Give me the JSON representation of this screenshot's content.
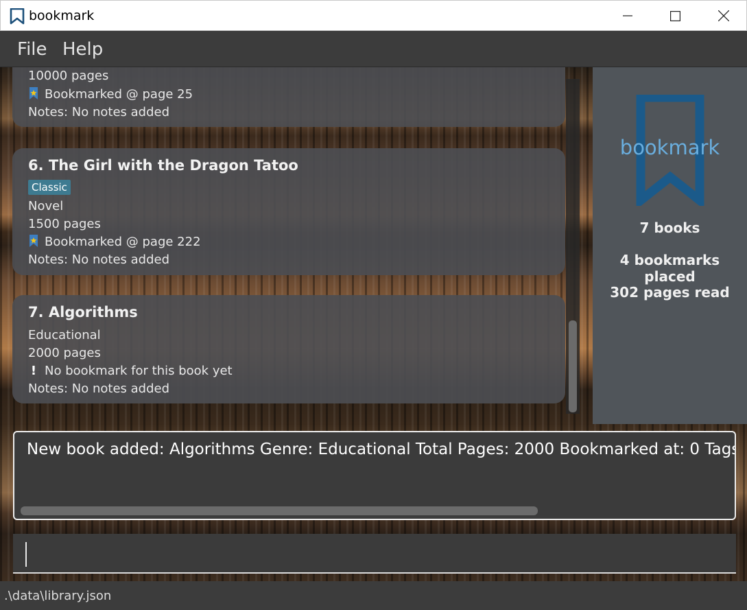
{
  "window": {
    "title": "bookmark"
  },
  "menu": {
    "file": "File",
    "help": "Help"
  },
  "books": [
    {
      "pages_partial": "10000 pages",
      "bookmark": "Bookmarked @ page 25",
      "notes": "Notes: No notes added"
    },
    {
      "name": "6.  The Girl with the Dragon Tatoo",
      "tag": "Classic",
      "genre": "Novel",
      "pages": "1500 pages",
      "bookmark": "Bookmarked @ page 222",
      "notes": "Notes: No notes added"
    },
    {
      "name": "7.  Algorithms",
      "genre": "Educational",
      "pages": "2000 pages",
      "bookmark": "No bookmark for this book yet",
      "notes": "Notes: No notes added"
    }
  ],
  "stats": {
    "logo_text": "bookmark",
    "books": "7 books",
    "bookmarks": "4 bookmarks placed",
    "pages_read": "302 pages read"
  },
  "result": {
    "message": "New book added: Algorithms Genre: Educational Total Pages: 2000 Bookmarked at: 0 Tags"
  },
  "command": {
    "value": ""
  },
  "status": {
    "path": ".\\data\\library.json"
  },
  "colors": {
    "card": "#4c4e52",
    "tag": "#3e7b91",
    "logo": "#1b5a8a",
    "logo_text": "#6aaede",
    "stats_panel": "#50555a"
  },
  "icons": {
    "app": "bookmark-icon",
    "bookmarked": "bookmark-star-icon",
    "no_bookmark": "exclamation-icon"
  }
}
